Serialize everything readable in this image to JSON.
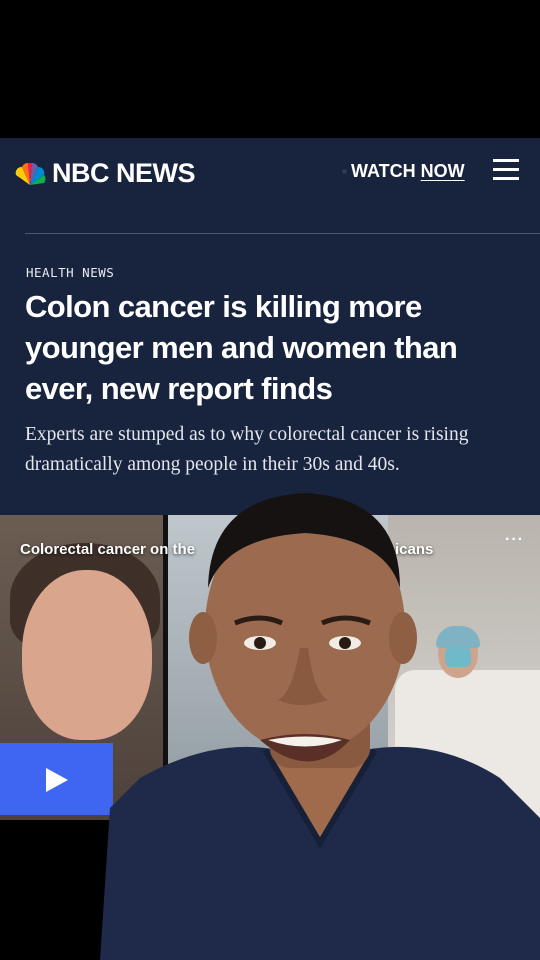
{
  "header": {
    "brand": "NBC NEWS",
    "watch_label": "WATCH",
    "now_label": "NOW"
  },
  "article": {
    "section": "HEALTH NEWS",
    "headline": "Colon cancer is killing more younger men and women than ever, new report finds",
    "dek": "Experts are stumped as to why colorectal cancer is rising dramatically among people in their 30s and 40s."
  },
  "video": {
    "caption_left": "Colorectal cancer on the",
    "caption_right": "icans",
    "more_label": "···"
  },
  "icons": [
    "peacock-logo-icon",
    "menu-icon",
    "play-icon",
    "more-icon"
  ],
  "colors": {
    "nav_bg": "#18233e",
    "play_button": "#3f66f0",
    "scrubs": "#1f2a4a"
  }
}
